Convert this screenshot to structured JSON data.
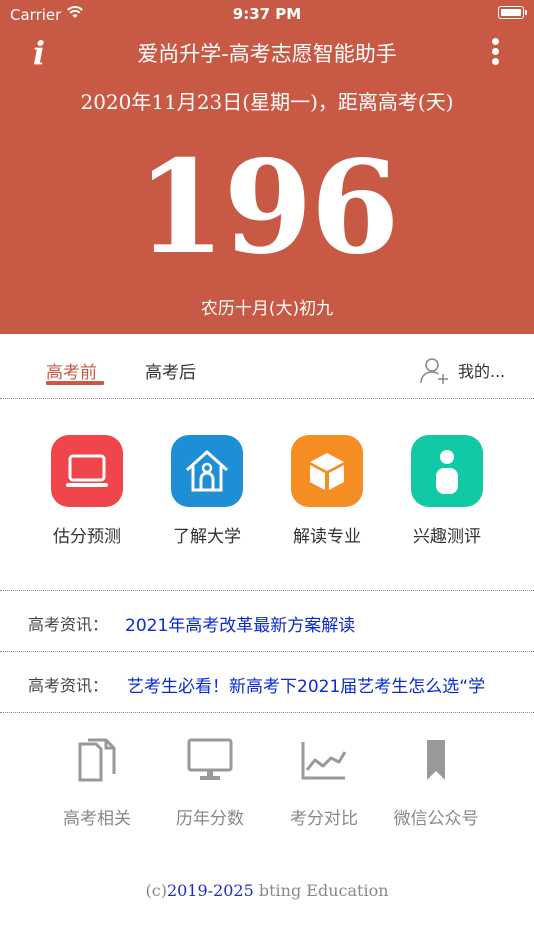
{
  "status_bar": {
    "carrier": "Carrier",
    "time": "9:37 PM"
  },
  "header": {
    "title": "爱尚升学-高考志愿智能助手",
    "date_line": "2020年11月23日(星期一)，距离高考(天)",
    "countdown_days": "196",
    "lunar_date": "农历十月(大)初九",
    "background_color": "#C85A45"
  },
  "tabs": [
    {
      "label": "高考前",
      "active": true
    },
    {
      "label": "高考后",
      "active": false
    }
  ],
  "mine_label": "我的...",
  "features": [
    {
      "label": "估分预测",
      "icon": "laptop-icon",
      "color": "#F0454A"
    },
    {
      "label": "了解大学",
      "icon": "school-icon",
      "color": "#1E8ED6"
    },
    {
      "label": "解读专业",
      "icon": "cube-icon",
      "color": "#F58D22"
    },
    {
      "label": "兴趣测评",
      "icon": "person-icon",
      "color": "#12C9A6"
    }
  ],
  "news": [
    {
      "label": "高考资讯：",
      "text": "2021年高考改革最新方案解读"
    },
    {
      "label": "高考资讯：",
      "text": "艺考生必看！新高考下2021届艺考生怎么选“学"
    }
  ],
  "tools": [
    {
      "label": "高考相关",
      "icon": "documents-icon"
    },
    {
      "label": "历年分数",
      "icon": "monitor-icon"
    },
    {
      "label": "考分对比",
      "icon": "line-chart-icon"
    },
    {
      "label": "微信公众号",
      "icon": "bookmark-icon"
    }
  ],
  "footer": {
    "prefix": "(c)",
    "years": "2019-2025",
    "company": " bting Education"
  }
}
